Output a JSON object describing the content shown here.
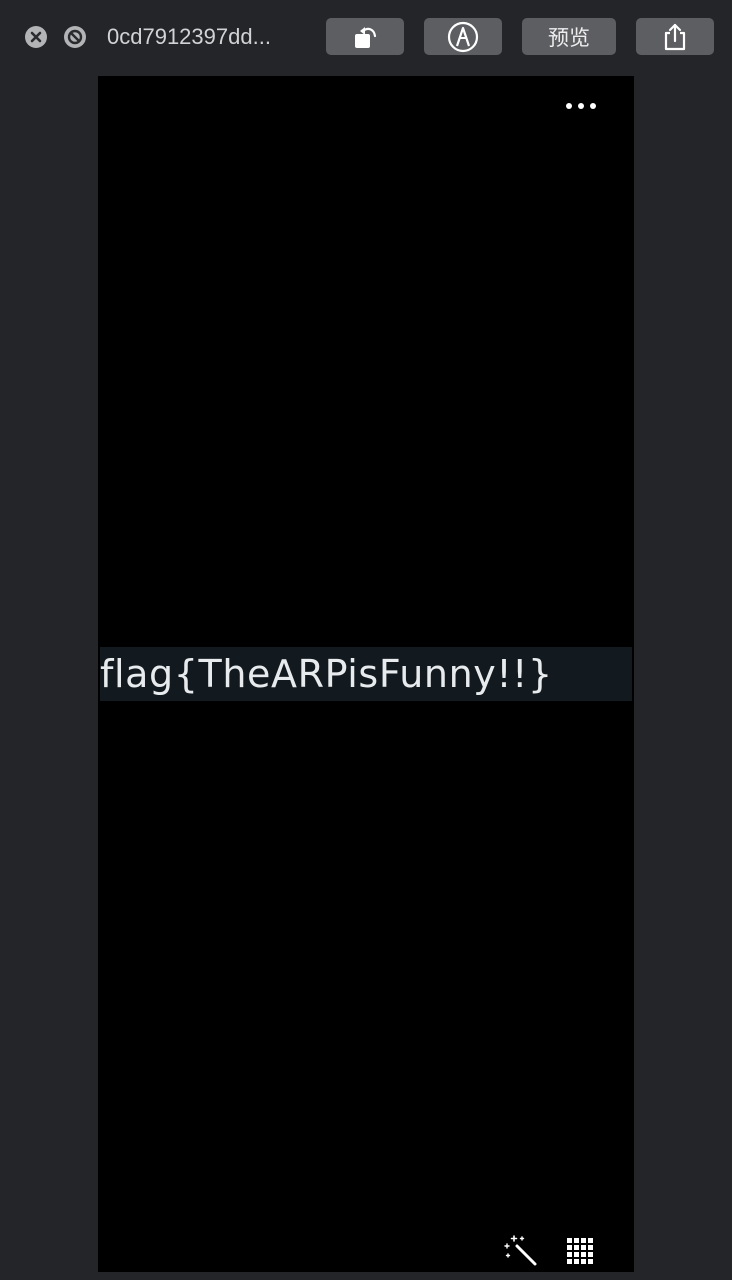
{
  "toolbar": {
    "filename": "0cd7912397dd...",
    "preview_label": "预览",
    "icons": {
      "close": "close-icon",
      "stop": "stop-icon",
      "rotate": "rotate-icon",
      "markup": "markup-icon",
      "share": "share-icon"
    }
  },
  "content": {
    "flag_text": "flag{TheARPisFunny!!}",
    "icons": {
      "more": "more-icon",
      "magic_wand": "magic-wand-icon",
      "grid": "grid-icon"
    }
  },
  "colors": {
    "window_bg": "#242529",
    "button_bg": "#5d5e62",
    "stage_bg": "#000000",
    "highlight_band": "#131a1f"
  }
}
